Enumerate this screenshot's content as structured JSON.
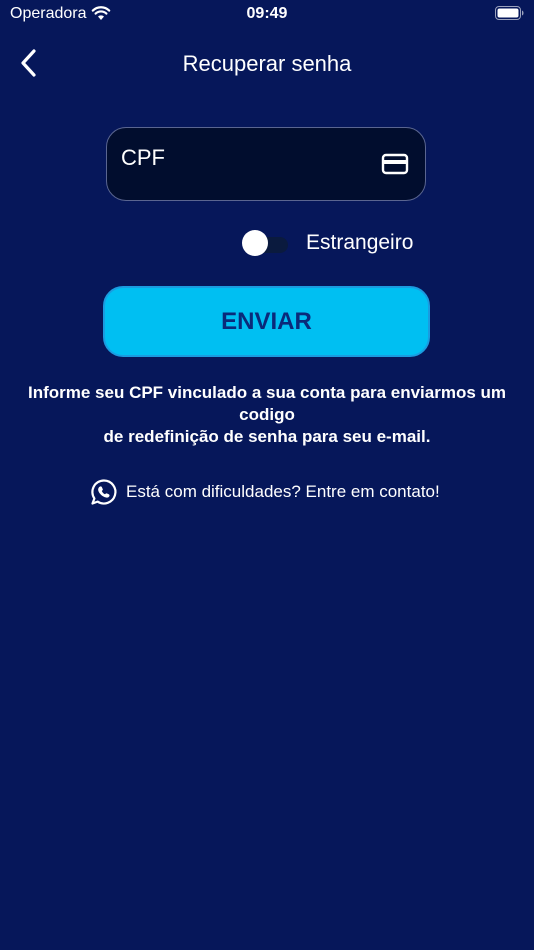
{
  "status_bar": {
    "carrier": "Operadora",
    "time": "09:49"
  },
  "nav": {
    "title": "Recuperar senha"
  },
  "form": {
    "cpf_placeholder": "CPF",
    "toggle_label": "Estrangeiro",
    "toggle_on": false,
    "submit_label": "ENVIAR"
  },
  "info": {
    "line1": "Informe seu CPF vinculado a sua conta para enviarmos um codigo",
    "line2": "de redefinição de senha para seu e-mail."
  },
  "contact": {
    "label": "Está com dificuldades? Entre em contato!"
  },
  "icons": {
    "back": "chevron-left-icon",
    "card": "credit-card-icon",
    "contact": "whatsapp-icon",
    "wifi": "wifi-icon",
    "battery": "battery-icon"
  },
  "colors": {
    "background": "#06175a",
    "field_background": "#010d2e",
    "button_background": "#00bff2",
    "button_text": "#0a2a7a"
  }
}
